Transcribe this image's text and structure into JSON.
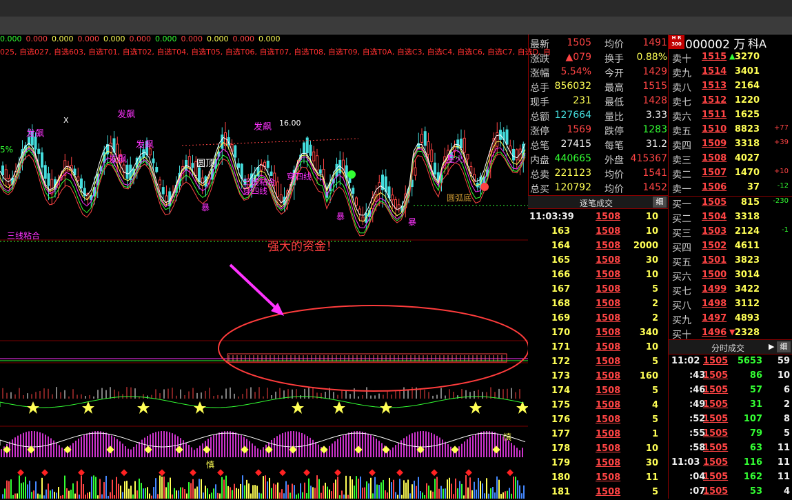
{
  "colors": {
    "up": "#ff4444",
    "down": "#33ff33",
    "volume": "#ffff55",
    "label": "#cccccc",
    "circle": "#ff3c3c",
    "arrow": "#ff33ff"
  },
  "indicator_values": [
    "0.000",
    "0.000",
    "0.000",
    "0.000",
    "0.000",
    "0.000",
    "0.000",
    "0.000",
    "0.000",
    "0.000",
    "0.000"
  ],
  "watchlist_tabs": "025, 自选027, 自选603, 自选T01, 自选T02, 自选T04, 自选T05, 自选T06, 自选T07, 自选T08, 自选T09, 自选T0A, 自选C3, 自选C4, 自选C6, 自选C7, 自选D, 自",
  "chart_labels": {
    "fapiao1": "发飙",
    "fapiao2": "发飙",
    "fapiao3": "发飙",
    "fapiao4": "发飙",
    "fapiao5": "发飙",
    "pct": "5%",
    "pk1600": "16.00",
    "yuanding": "圆顶",
    "yuandidi": "圆弧底",
    "xingtuo": "星火",
    "chuansi1": "穿四线",
    "chuansi2": "穿四线",
    "sanxian1": "三线粘合",
    "sanxian2": "三线粘合",
    "bao1": "暴",
    "bao2": "暴",
    "bao3": "暴",
    "x": "X",
    "hui1": "慎",
    "hui2": "慎"
  },
  "annotation": "强大的资金！",
  "stock": {
    "logo_top": "H R",
    "logo_bottom": "300",
    "code": "000002",
    "unit": "万",
    "name": "科A"
  },
  "quote": [
    {
      "l1": "最新",
      "v1": "1505",
      "c1": "red",
      "l2": "均价",
      "v2": "1491",
      "c2": "red"
    },
    {
      "l1": "涨跌",
      "v1": "▲079",
      "c1": "red",
      "l2": "换手",
      "v2": "0.88%",
      "c2": "yel"
    },
    {
      "l1": "涨幅",
      "v1": "5.54%",
      "c1": "red",
      "l2": "今开",
      "v2": "1429",
      "c2": "red"
    },
    {
      "l1": "总手",
      "v1": "856032",
      "c1": "yel",
      "l2": "最高",
      "v2": "1515",
      "c2": "red"
    },
    {
      "l1": "现手",
      "v1": "231",
      "c1": "yel",
      "l2": "最低",
      "v2": "1428",
      "c2": "red"
    },
    {
      "l1": "总额",
      "v1": "127664",
      "c1": "cyn",
      "l2": "量比",
      "v2": "3.33",
      "c2": "wht"
    },
    {
      "l1": "涨停",
      "v1": "1569",
      "c1": "red",
      "l2": "跌停",
      "v2": "1283",
      "c2": "grn"
    },
    {
      "l1": "总笔",
      "v1": "27415",
      "c1": "wht",
      "l2": "每笔",
      "v2": "31.2",
      "c2": "wht"
    },
    {
      "l1": "内盘",
      "v1": "440665",
      "c1": "grn",
      "l2": "外盘",
      "v2": "415367",
      "c2": "red"
    },
    {
      "l1": "总卖",
      "v1": "221123",
      "c1": "yel",
      "l2": "均价",
      "v2": "1541",
      "c2": "red"
    },
    {
      "l1": "总买",
      "v1": "120792",
      "c1": "yel",
      "l2": "均价",
      "v2": "1452",
      "c2": "red"
    }
  ],
  "panel_tick": {
    "title": "逐笔成交",
    "btn": "细"
  },
  "tick_first": {
    "t": "11:03:39",
    "p": "1508",
    "v": "10"
  },
  "ticks": [
    {
      "n": "163",
      "p": "1508",
      "v": "10"
    },
    {
      "n": "164",
      "p": "1508",
      "v": "2000"
    },
    {
      "n": "165",
      "p": "1508",
      "v": "30"
    },
    {
      "n": "166",
      "p": "1508",
      "v": "10"
    },
    {
      "n": "167",
      "p": "1508",
      "v": "5"
    },
    {
      "n": "168",
      "p": "1508",
      "v": "2"
    },
    {
      "n": "169",
      "p": "1508",
      "v": "2"
    },
    {
      "n": "170",
      "p": "1508",
      "v": "340"
    },
    {
      "n": "171",
      "p": "1508",
      "v": "10"
    },
    {
      "n": "172",
      "p": "1508",
      "v": "5"
    },
    {
      "n": "173",
      "p": "1508",
      "v": "160"
    },
    {
      "n": "174",
      "p": "1508",
      "v": "5"
    },
    {
      "n": "175",
      "p": "1508",
      "v": "4"
    },
    {
      "n": "176",
      "p": "1508",
      "v": "5"
    },
    {
      "n": "177",
      "p": "1508",
      "v": "1"
    },
    {
      "n": "178",
      "p": "1508",
      "v": "10"
    },
    {
      "n": "179",
      "p": "1508",
      "v": "30"
    },
    {
      "n": "180",
      "p": "1508",
      "v": "11"
    },
    {
      "n": "181",
      "p": "1508",
      "v": "5"
    }
  ],
  "asks": [
    {
      "l": "卖十",
      "p": "1515",
      "v": "3270",
      "arrow": "up",
      "c": ""
    },
    {
      "l": "卖九",
      "p": "1514",
      "v": "3401",
      "c": ""
    },
    {
      "l": "卖八",
      "p": "1513",
      "v": "2164",
      "c": ""
    },
    {
      "l": "卖七",
      "p": "1512",
      "v": "1220",
      "c": ""
    },
    {
      "l": "卖六",
      "p": "1511",
      "v": "1625",
      "c": ""
    },
    {
      "l": "卖五",
      "p": "1510",
      "v": "8823",
      "c": "+77"
    },
    {
      "l": "卖四",
      "p": "1509",
      "v": "3318",
      "c": "+39"
    },
    {
      "l": "卖三",
      "p": "1508",
      "v": "4027",
      "c": ""
    },
    {
      "l": "卖二",
      "p": "1507",
      "v": "1470",
      "c": "+10"
    },
    {
      "l": "卖一",
      "p": "1506",
      "v": "37",
      "c": "-12"
    }
  ],
  "bids": [
    {
      "l": "买一",
      "p": "1505",
      "v": "815",
      "c": "-230"
    },
    {
      "l": "买二",
      "p": "1504",
      "v": "3318",
      "c": ""
    },
    {
      "l": "买三",
      "p": "1503",
      "v": "2124",
      "c": "-1"
    },
    {
      "l": "买四",
      "p": "1502",
      "v": "4611",
      "c": ""
    },
    {
      "l": "买五",
      "p": "1501",
      "v": "3823",
      "c": ""
    },
    {
      "l": "买六",
      "p": "1500",
      "v": "3014",
      "c": ""
    },
    {
      "l": "买七",
      "p": "1499",
      "v": "3422",
      "c": ""
    },
    {
      "l": "买八",
      "p": "1498",
      "v": "3112",
      "c": ""
    },
    {
      "l": "买九",
      "p": "1497",
      "v": "4893",
      "c": ""
    },
    {
      "l": "买十",
      "p": "1496",
      "v": "2328",
      "arrow": "down",
      "c": ""
    }
  ],
  "panel_min": {
    "title": "分时成交",
    "arrow": "▶",
    "btn": "细"
  },
  "minute_ticks": [
    {
      "t": "11:02",
      "p": "1505",
      "v": "5653",
      "n": "59",
      "vc": "grn"
    },
    {
      "t": ":43",
      "p": "1505",
      "v": "86",
      "n": "10",
      "vc": "grn"
    },
    {
      "t": ":46",
      "p": "1505",
      "v": "57",
      "n": "6",
      "vc": "grn"
    },
    {
      "t": ":49",
      "p": "1505",
      "v": "31",
      "n": "2",
      "vc": "grn"
    },
    {
      "t": ":52",
      "p": "1505",
      "v": "107",
      "n": "8",
      "vc": "grn"
    },
    {
      "t": ":55",
      "p": "1505",
      "v": "79",
      "n": "5",
      "vc": "grn"
    },
    {
      "t": ":58",
      "p": "1505",
      "v": "63",
      "n": "11",
      "vc": "grn"
    },
    {
      "t": "11:03",
      "p": "1505",
      "v": "116",
      "n": "11",
      "vc": "grn"
    },
    {
      "t": ":04",
      "p": "1505",
      "v": "162",
      "n": "11",
      "vc": "grn"
    },
    {
      "t": ":07",
      "p": "1505",
      "v": "53",
      "n": "4",
      "vc": "grn"
    }
  ]
}
